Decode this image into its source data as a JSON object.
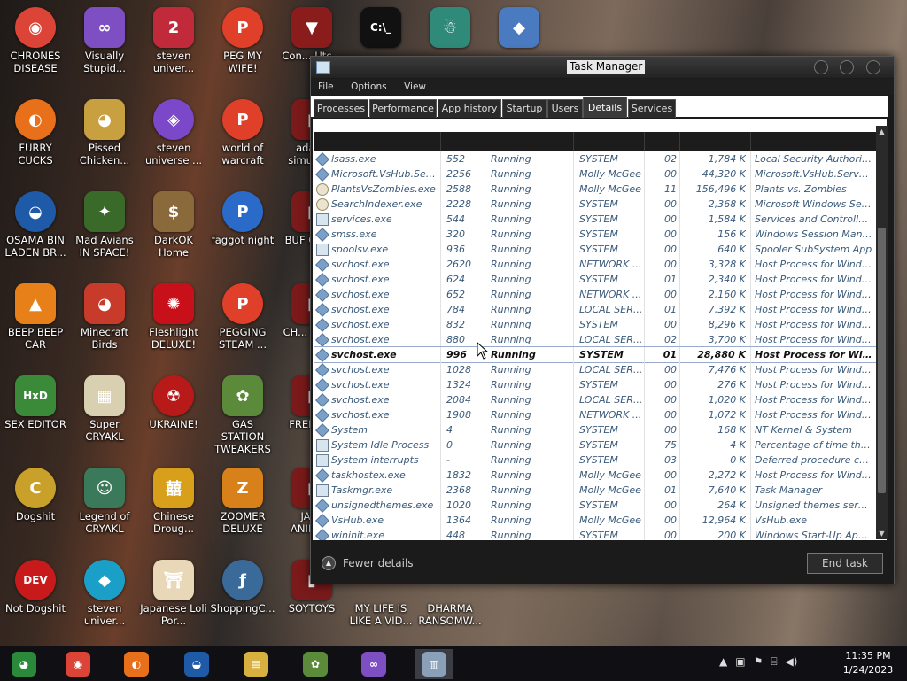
{
  "desktop": {
    "icons": [
      {
        "label": "CHRONES DISEASE",
        "icon": "chrome-icon",
        "color": "#db4437",
        "glyph": "◉"
      },
      {
        "label": "Visually Stupid...",
        "icon": "visual-studio-icon",
        "color": "#7e4fc2",
        "glyph": "∞"
      },
      {
        "label": "steven univer...",
        "icon": "steven-universe-2-icon",
        "color": "#c02a3a",
        "glyph": "2"
      },
      {
        "label": "PEG MY WIFE!",
        "icon": "peggle-icon",
        "color": "#e0402a",
        "glyph": "P"
      },
      {
        "label": "Con... Utc...",
        "icon": "red-emblem-icon",
        "color": "#8a1c1c",
        "glyph": "▼"
      },
      {
        "label": "",
        "icon": "cmd-icon",
        "color": "#111111",
        "glyph": "C:\\_"
      },
      {
        "label": "",
        "icon": "santa-icon",
        "color": "#2f8a7a",
        "glyph": "☃"
      },
      {
        "label": "",
        "icon": "blue-diamond-icon",
        "color": "#4a7ac0",
        "glyph": "◆"
      },
      {
        "label": "FURRY CUCKS",
        "icon": "firefox-icon",
        "color": "#e8701a",
        "glyph": "◐"
      },
      {
        "label": "Pissed Chicken...",
        "icon": "angry-birds-seasons-icon",
        "color": "#c8a040",
        "glyph": "◕"
      },
      {
        "label": "steven universe ...",
        "icon": "gem-ring-icon",
        "color": "#7a48c8",
        "glyph": "◈"
      },
      {
        "label": "world of warcraft",
        "icon": "peggle-icon",
        "color": "#e0402a",
        "glyph": "P"
      },
      {
        "label": "adami simulat...",
        "icon": "red-tile-icon",
        "color": "#7a1a1a",
        "glyph": "▮"
      },
      {
        "label": "OSAMA BIN LADEN BR...",
        "icon": "obama-logo-icon",
        "color": "#1e5aa8",
        "glyph": "◒"
      },
      {
        "label": "Mad Avians IN SPACE!",
        "icon": "angry-birds-space-icon",
        "color": "#3a6a2a",
        "glyph": "✦"
      },
      {
        "label": "DarkOK Home",
        "icon": "money-bag-icon",
        "color": "#8a6a3a",
        "glyph": "$"
      },
      {
        "label": "faggot night",
        "icon": "peggle-nights-icon",
        "color": "#2a6ac8",
        "glyph": "P"
      },
      {
        "label": "BUF OUT...",
        "icon": "red-tile-icon",
        "color": "#7a1a1a",
        "glyph": "▮"
      },
      {
        "label": "BEEP BEEP CAR",
        "icon": "vlc-icon",
        "color": "#e8801a",
        "glyph": "▲"
      },
      {
        "label": "Minecraft Birds",
        "icon": "angry-bird-icon",
        "color": "#c83a2a",
        "glyph": "◕"
      },
      {
        "label": "Fleshlight DELUXE!",
        "icon": "red-fuzzy-icon",
        "color": "#c8101a",
        "glyph": "✺"
      },
      {
        "label": "PEGGING STEAM ...",
        "icon": "peggle-icon",
        "color": "#e0402a",
        "glyph": "P"
      },
      {
        "label": "CH... NUT...",
        "icon": "red-tile-icon",
        "color": "#7a1a1a",
        "glyph": "▮"
      },
      {
        "label": "SEX EDITOR",
        "icon": "hxd-icon",
        "color": "#3a8a3a",
        "glyph": "HxD"
      },
      {
        "label": "Super CRYAKL",
        "icon": "pixel-cat-icon",
        "color": "#d8d0b0",
        "glyph": "▦"
      },
      {
        "label": "UKRAINE!",
        "icon": "radiation-icon",
        "color": "#b81a1a",
        "glyph": "☢"
      },
      {
        "label": "GAS STATION TWEAKERS",
        "icon": "plants-vs-zombies-icon",
        "color": "#5a8a3a",
        "glyph": "✿"
      },
      {
        "label": "FREEBI...",
        "icon": "red-tile-icon",
        "color": "#7a1a1a",
        "glyph": "▮"
      },
      {
        "label": "Dogshit",
        "icon": "c-sharp-icon",
        "color": "#c8a02a",
        "glyph": "C"
      },
      {
        "label": "Legend of CRYAKL",
        "icon": "pixel-hero-icon",
        "color": "#3a7a5a",
        "glyph": "☺"
      },
      {
        "label": "Chinese Droug...",
        "icon": "mahjong-icon",
        "color": "#d8a01a",
        "glyph": "囍"
      },
      {
        "label": "ZOOMER DELUXE",
        "icon": "zuma-icon",
        "color": "#d8801a",
        "glyph": "Z"
      },
      {
        "label": "JAPA ANIME...",
        "icon": "red-tile-icon",
        "color": "#7a1a1a",
        "glyph": "▮"
      },
      {
        "label": "Not Dogshit",
        "icon": "dev-cpp-icon",
        "color": "#c81a1a",
        "glyph": "DEV"
      },
      {
        "label": "steven univer...",
        "icon": "cyan-gem-icon",
        "color": "#1aa0c8",
        "glyph": "◆"
      },
      {
        "label": "Japanese Loli Por...",
        "icon": "torii-icon",
        "color": "#e8d8b8",
        "glyph": "⛩"
      },
      {
        "label": "ShoppingC...",
        "icon": "flash-icon",
        "color": "#3a6a9a",
        "glyph": "ƒ"
      },
      {
        "label": "SOYTOYS",
        "icon": "red-tile-icon",
        "color": "#7a1a1a",
        "glyph": "▮"
      },
      {
        "label": "MY LIFE IS LIKE A VID...",
        "icon": "",
        "color": "",
        "glyph": ""
      },
      {
        "label": "DHARMA RANSOMW...",
        "icon": "",
        "color": "",
        "glyph": ""
      }
    ]
  },
  "task_manager": {
    "title": "Task Manager",
    "menu": [
      "File",
      "Options",
      "View"
    ],
    "tabs": [
      "Processes",
      "Performance",
      "App history",
      "Startup",
      "Users",
      "Details",
      "Services"
    ],
    "active_tab": "Details",
    "rows": [
      {
        "name": "lsass.exe",
        "pid": "552",
        "status": "Running",
        "user": "SYSTEM",
        "cpu": "02",
        "mem": "1,784 K",
        "desc": "Local Security Authority...",
        "icon": "diamond"
      },
      {
        "name": "Microsoft.VsHub.Serv...",
        "pid": "2256",
        "status": "Running",
        "user": "Molly McGee",
        "cpu": "00",
        "mem": "44,320 K",
        "desc": "Microsoft.VsHub.Server...",
        "icon": "diamond"
      },
      {
        "name": "PlantsVsZombies.exe",
        "pid": "2588",
        "status": "Running",
        "user": "Molly McGee",
        "cpu": "11",
        "mem": "156,496 K",
        "desc": "Plants vs. Zombies",
        "icon": "ring"
      },
      {
        "name": "SearchIndexer.exe",
        "pid": "2228",
        "status": "Running",
        "user": "SYSTEM",
        "cpu": "00",
        "mem": "2,368 K",
        "desc": "Microsoft Windows Sea...",
        "icon": "ring"
      },
      {
        "name": "services.exe",
        "pid": "544",
        "status": "Running",
        "user": "SYSTEM",
        "cpu": "00",
        "mem": "1,584 K",
        "desc": "Services and Controller ...",
        "icon": "square"
      },
      {
        "name": "smss.exe",
        "pid": "320",
        "status": "Running",
        "user": "SYSTEM",
        "cpu": "00",
        "mem": "156 K",
        "desc": "Windows Session Mana...",
        "icon": "diamond"
      },
      {
        "name": "spoolsv.exe",
        "pid": "936",
        "status": "Running",
        "user": "SYSTEM",
        "cpu": "00",
        "mem": "640 K",
        "desc": "Spooler SubSystem App",
        "icon": "square"
      },
      {
        "name": "svchost.exe",
        "pid": "2620",
        "status": "Running",
        "user": "NETWORK ...",
        "cpu": "00",
        "mem": "3,328 K",
        "desc": "Host Process for Windo...",
        "icon": "diamond"
      },
      {
        "name": "svchost.exe",
        "pid": "624",
        "status": "Running",
        "user": "SYSTEM",
        "cpu": "01",
        "mem": "2,340 K",
        "desc": "Host Process for Windo...",
        "icon": "diamond"
      },
      {
        "name": "svchost.exe",
        "pid": "652",
        "status": "Running",
        "user": "NETWORK ...",
        "cpu": "00",
        "mem": "2,160 K",
        "desc": "Host Process for Windo...",
        "icon": "diamond"
      },
      {
        "name": "svchost.exe",
        "pid": "784",
        "status": "Running",
        "user": "LOCAL SER...",
        "cpu": "01",
        "mem": "7,392 K",
        "desc": "Host Process for Windo...",
        "icon": "diamond"
      },
      {
        "name": "svchost.exe",
        "pid": "832",
        "status": "Running",
        "user": "SYSTEM",
        "cpu": "00",
        "mem": "8,296 K",
        "desc": "Host Process for Windo...",
        "icon": "diamond"
      },
      {
        "name": "svchost.exe",
        "pid": "880",
        "status": "Running",
        "user": "LOCAL SER...",
        "cpu": "02",
        "mem": "3,700 K",
        "desc": "Host Process for Windo...",
        "icon": "diamond"
      },
      {
        "name": "svchost.exe",
        "pid": "996",
        "status": "Running",
        "user": "SYSTEM",
        "cpu": "01",
        "mem": "28,880 K",
        "desc": "Host Process for Windo...",
        "icon": "diamond",
        "selected": true
      },
      {
        "name": "svchost.exe",
        "pid": "1028",
        "status": "Running",
        "user": "LOCAL SER...",
        "cpu": "00",
        "mem": "7,476 K",
        "desc": "Host Process for Windo...",
        "icon": "diamond"
      },
      {
        "name": "svchost.exe",
        "pid": "1324",
        "status": "Running",
        "user": "SYSTEM",
        "cpu": "00",
        "mem": "276 K",
        "desc": "Host Process for Windo...",
        "icon": "diamond"
      },
      {
        "name": "svchost.exe",
        "pid": "2084",
        "status": "Running",
        "user": "LOCAL SER...",
        "cpu": "00",
        "mem": "1,020 K",
        "desc": "Host Process for Windo...",
        "icon": "diamond"
      },
      {
        "name": "svchost.exe",
        "pid": "1908",
        "status": "Running",
        "user": "NETWORK ...",
        "cpu": "00",
        "mem": "1,072 K",
        "desc": "Host Process for Windo...",
        "icon": "diamond"
      },
      {
        "name": "System",
        "pid": "4",
        "status": "Running",
        "user": "SYSTEM",
        "cpu": "00",
        "mem": "168 K",
        "desc": "NT Kernel & System",
        "icon": "diamond"
      },
      {
        "name": "System Idle Process",
        "pid": "0",
        "status": "Running",
        "user": "SYSTEM",
        "cpu": "75",
        "mem": "4 K",
        "desc": "Percentage of time the ...",
        "icon": "square"
      },
      {
        "name": "System interrupts",
        "pid": "-",
        "status": "Running",
        "user": "SYSTEM",
        "cpu": "03",
        "mem": "0 K",
        "desc": "Deferred procedure call...",
        "icon": "square"
      },
      {
        "name": "taskhostex.exe",
        "pid": "1832",
        "status": "Running",
        "user": "Molly McGee",
        "cpu": "00",
        "mem": "2,272 K",
        "desc": "Host Process for Windo...",
        "icon": "diamond"
      },
      {
        "name": "Taskmgr.exe",
        "pid": "2368",
        "status": "Running",
        "user": "Molly McGee",
        "cpu": "01",
        "mem": "7,640 K",
        "desc": "Task Manager",
        "icon": "square"
      },
      {
        "name": "unsignedthemes.exe",
        "pid": "1020",
        "status": "Running",
        "user": "SYSTEM",
        "cpu": "00",
        "mem": "264 K",
        "desc": "Unsigned themes servic...",
        "icon": "diamond"
      },
      {
        "name": "VsHub.exe",
        "pid": "1364",
        "status": "Running",
        "user": "Molly McGee",
        "cpu": "00",
        "mem": "12,964 K",
        "desc": "VsHub.exe",
        "icon": "diamond"
      },
      {
        "name": "wininit.exe",
        "pid": "448",
        "status": "Running",
        "user": "SYSTEM",
        "cpu": "00",
        "mem": "200 K",
        "desc": "Windows Start-Up Appli...",
        "icon": "diamond"
      }
    ],
    "footer": {
      "fewer_details": "Fewer details",
      "end_task": "End task"
    }
  },
  "taskbar": {
    "items": [
      {
        "icon": "start-orb-icon",
        "color": "#2a8a3a",
        "glyph": "◕"
      },
      {
        "icon": "chrome-icon",
        "color": "#db4437",
        "glyph": "◉"
      },
      {
        "icon": "firefox-icon",
        "color": "#e8701a",
        "glyph": "◐"
      },
      {
        "icon": "obama-logo-icon",
        "color": "#1e5aa8",
        "glyph": "◒"
      },
      {
        "icon": "file-explorer-icon",
        "color": "#d8b040",
        "glyph": "▤"
      },
      {
        "icon": "plants-vs-zombies-icon",
        "color": "#5a8a3a",
        "glyph": "✿"
      },
      {
        "icon": "visual-studio-icon",
        "color": "#7e4fc2",
        "glyph": "∞"
      },
      {
        "icon": "task-manager-icon",
        "color": "#8aa0b8",
        "glyph": "▥",
        "active": true
      }
    ],
    "tray": [
      "▲",
      "▣",
      "⚑",
      "⌸",
      "◀)"
    ],
    "time": "11:35 PM",
    "date": "1/24/2023"
  }
}
